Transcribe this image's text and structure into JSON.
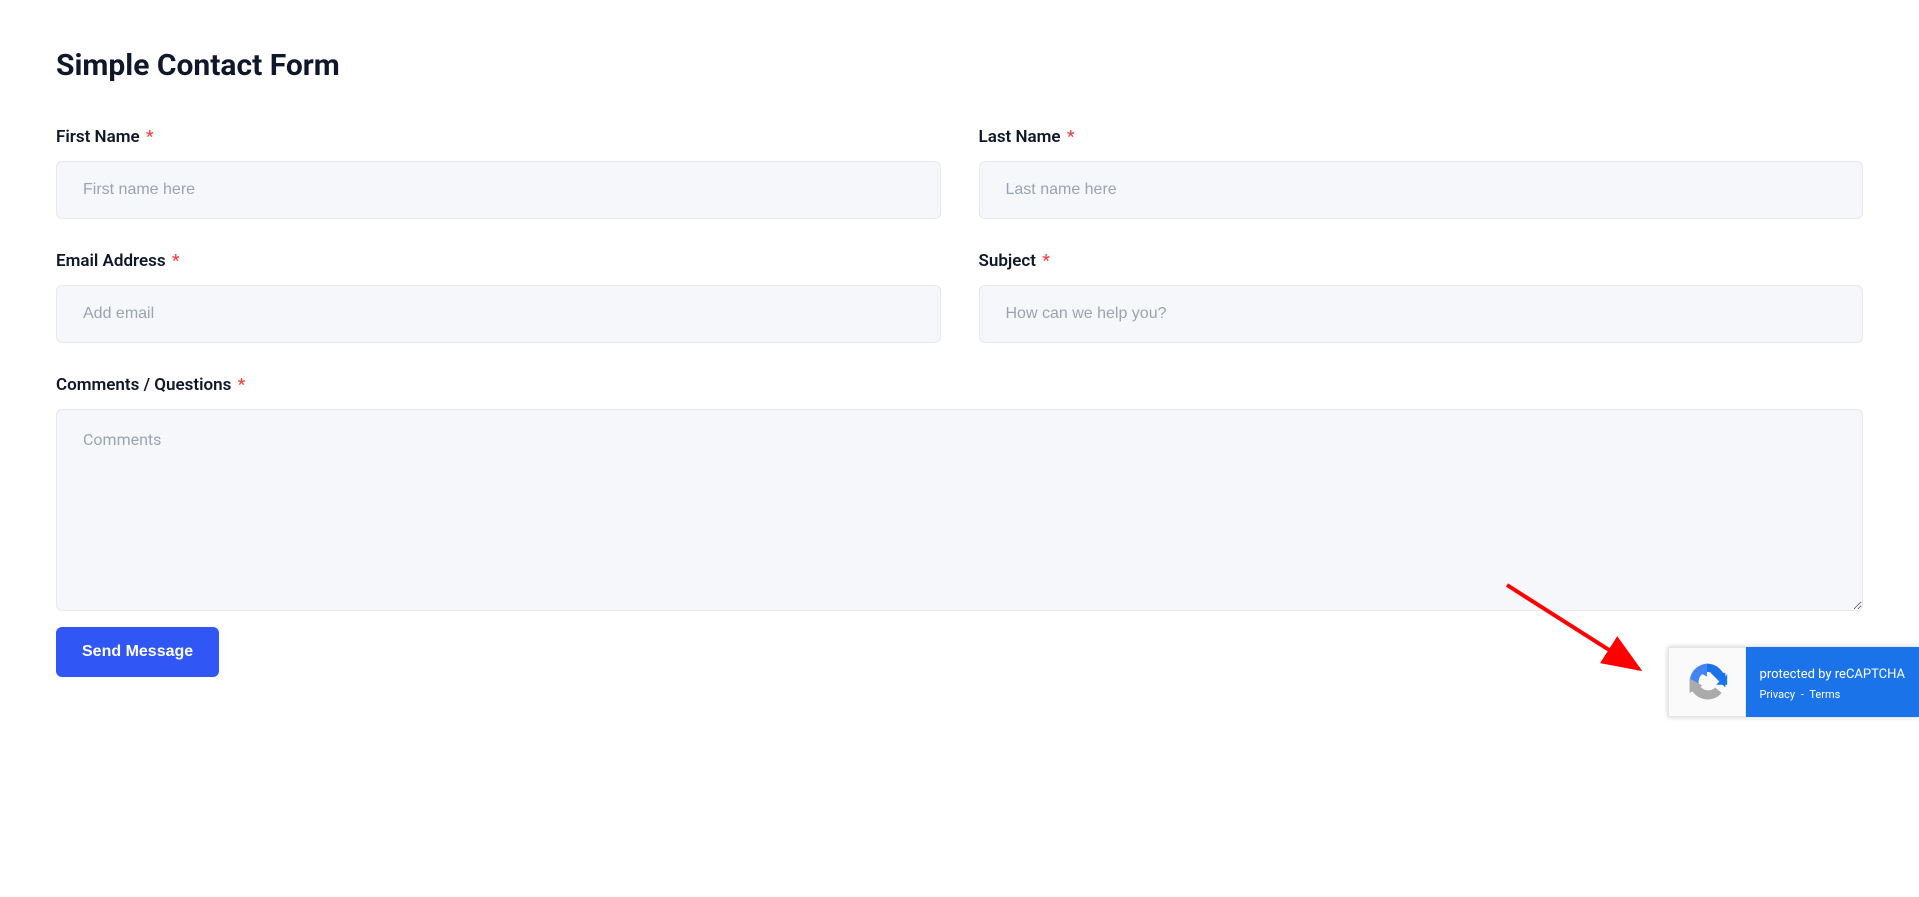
{
  "form": {
    "title": "Simple Contact Form",
    "first_name": {
      "label": "First Name",
      "placeholder": "First name here",
      "value": ""
    },
    "last_name": {
      "label": "Last Name",
      "placeholder": "Last name here",
      "value": ""
    },
    "email": {
      "label": "Email Address",
      "placeholder": "Add email",
      "value": ""
    },
    "subject": {
      "label": "Subject",
      "placeholder": "How can we help you?",
      "value": ""
    },
    "comments": {
      "label": "Comments / Questions",
      "placeholder": "Comments",
      "value": ""
    },
    "submit_label": "Send Message",
    "required_marker": "*"
  },
  "recaptcha": {
    "title": "protected by reCAPTCHA",
    "privacy": "Privacy",
    "terms": "Terms",
    "separator": "-"
  }
}
